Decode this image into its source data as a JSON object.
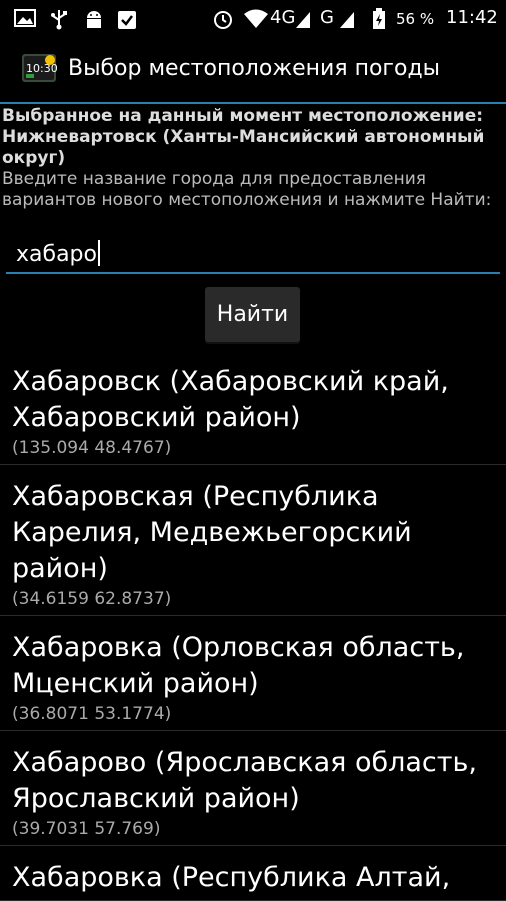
{
  "status_bar": {
    "battery_percent": "56 %",
    "time": "11:42",
    "signal_4g": "4G",
    "signal_g": "G",
    "icons": [
      "image-icon",
      "usb-icon",
      "android-icon",
      "clipboard-icon",
      "alarm-icon",
      "wifi-icon",
      "signal-icon",
      "battery-icon"
    ]
  },
  "header": {
    "title": "Выбор местоположения погоды",
    "icon": "weather-widget-icon"
  },
  "info": {
    "current_label": "Выбранное на данный момент местоположение:",
    "current_value": "Нижневартовск (Ханты-Мансийский автономный округ)",
    "hint": "Введите название города для предоставления вариантов нового местоположения и нажмите Найти:"
  },
  "search": {
    "value": "хабаро"
  },
  "find_button": {
    "label": "Найти"
  },
  "results": [
    {
      "name": "Хабаровск (Хабаровский край, Хабаровский район)",
      "coords": "(135.094 48.4767)"
    },
    {
      "name": "Хабаровская (Республика Карелия, Медвежьегорский район)",
      "coords": "(34.6159 62.8737)"
    },
    {
      "name": "Хабаровка (Орловская область, Мценский район)",
      "coords": "(36.8071 53.1774)"
    },
    {
      "name": "Хабарово (Ярославская область, Ярославский район)",
      "coords": "(39.7031 57.769)"
    },
    {
      "name": "Хабаровка (Республика Алтай,",
      "coords": ""
    }
  ]
}
